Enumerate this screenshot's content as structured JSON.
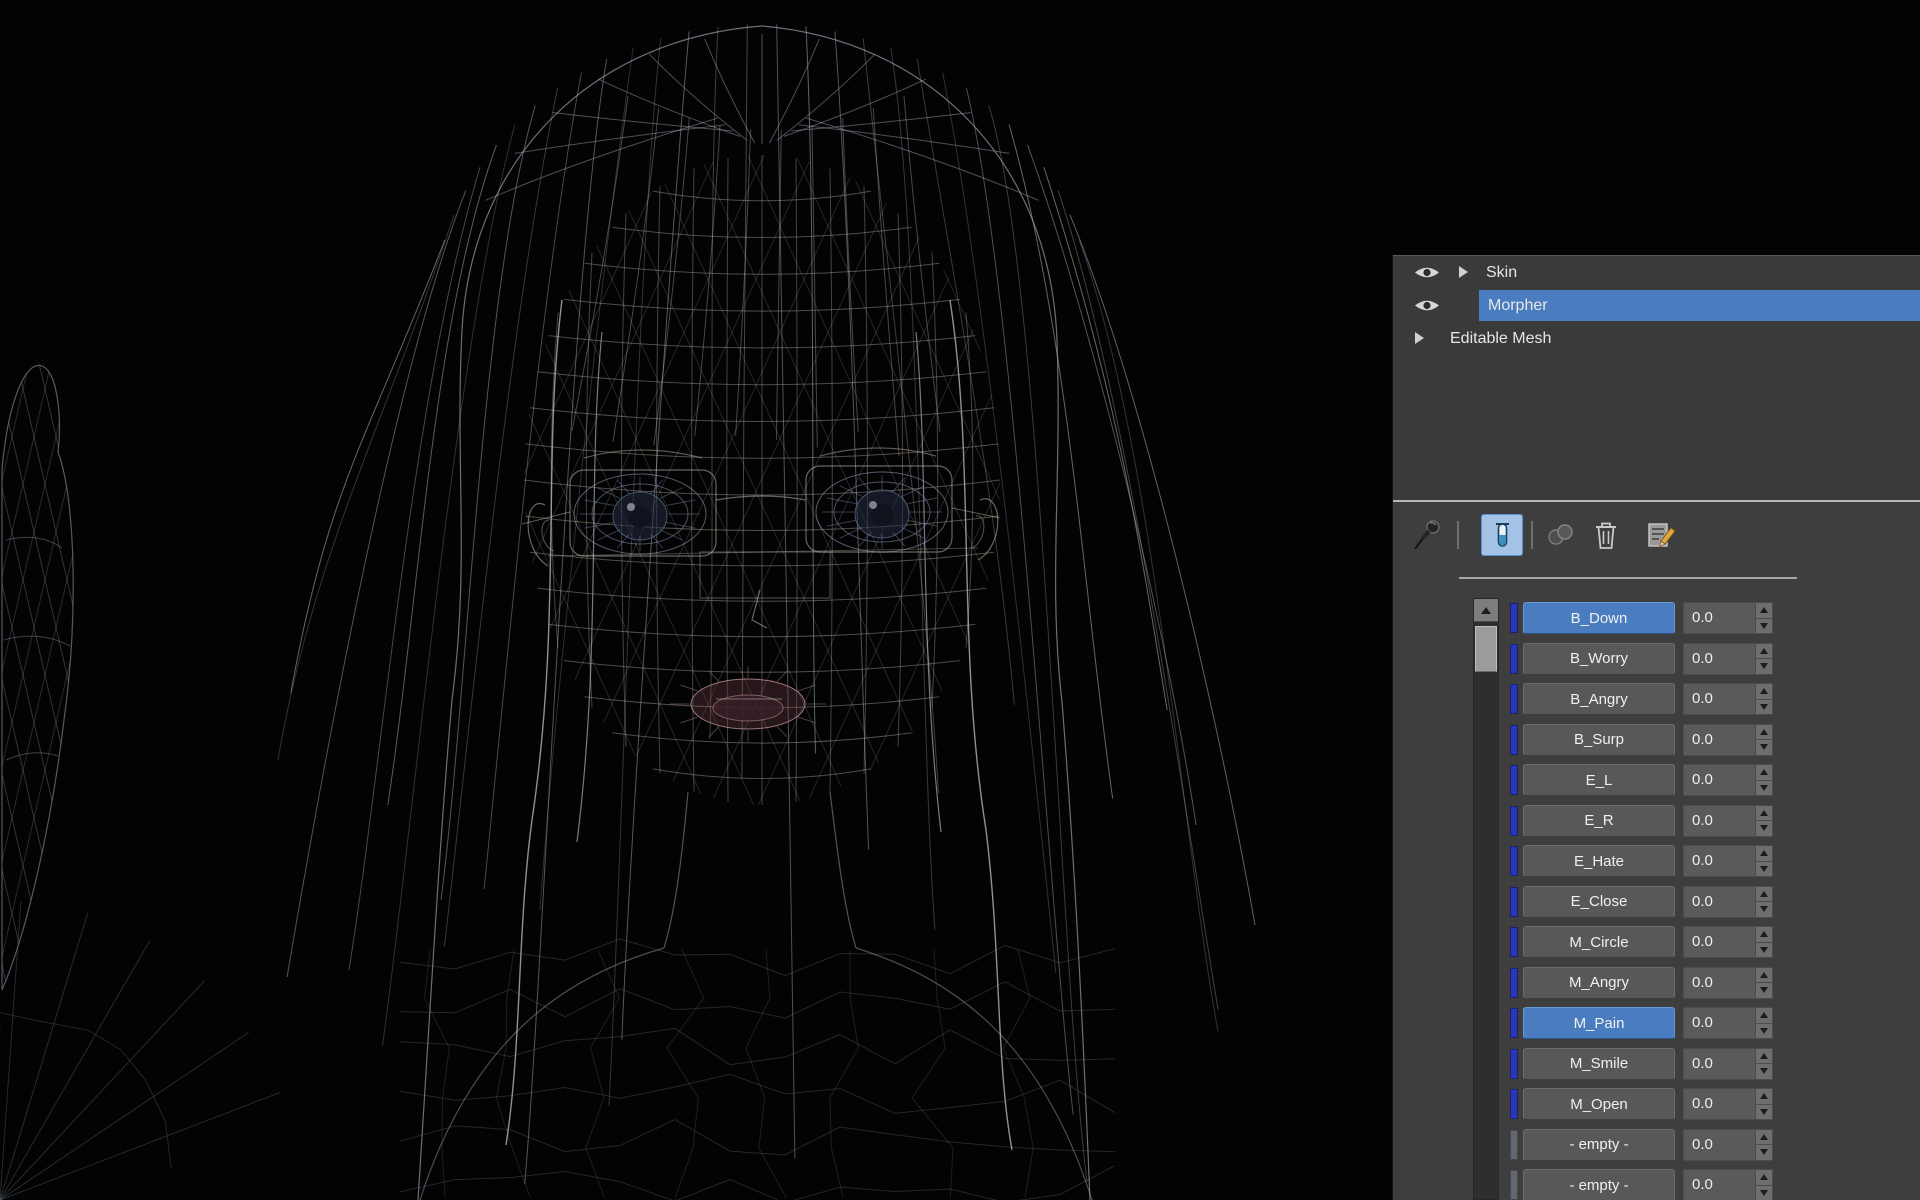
{
  "colors": {
    "selection_blue": "#4a7dbf",
    "panel_bg": "#3e3e3e",
    "channel_marker_blue": "#2936b8",
    "viewport_bg": "#030303"
  },
  "modifier_stack": {
    "items": [
      {
        "label": "Skin",
        "eye_visible": true,
        "expand_arrow": true,
        "selected": false
      },
      {
        "label": "Morpher",
        "eye_visible": true,
        "expand_arrow": false,
        "selected": true
      },
      {
        "label": "Editable Mesh",
        "eye_visible": false,
        "expand_arrow": true,
        "selected": false
      }
    ]
  },
  "stack_toolbar": {
    "buttons": [
      {
        "name": "pin-stack",
        "icon": "pushpin-icon",
        "active": false,
        "disabled": false
      },
      {
        "name": "show-end-result",
        "icon": "test-tube-icon",
        "active": true,
        "disabled": false
      },
      {
        "name": "make-unique",
        "icon": "two-spheres-icon",
        "active": false,
        "disabled": true
      },
      {
        "name": "remove-modifier",
        "icon": "trash-icon",
        "active": false,
        "disabled": false
      },
      {
        "name": "configure-modifier-sets",
        "icon": "list-pencil-icon",
        "active": false,
        "disabled": false
      }
    ]
  },
  "morph_channels": {
    "rows": [
      {
        "name": "B_Down",
        "value": "0.0",
        "selected": true,
        "empty": false
      },
      {
        "name": "B_Worry",
        "value": "0.0",
        "selected": false,
        "empty": false
      },
      {
        "name": "B_Angry",
        "value": "0.0",
        "selected": false,
        "empty": false
      },
      {
        "name": "B_Surp",
        "value": "0.0",
        "selected": false,
        "empty": false
      },
      {
        "name": "E_L",
        "value": "0.0",
        "selected": false,
        "empty": false
      },
      {
        "name": "E_R",
        "value": "0.0",
        "selected": false,
        "empty": false
      },
      {
        "name": "E_Hate",
        "value": "0.0",
        "selected": false,
        "empty": false
      },
      {
        "name": "E_Close",
        "value": "0.0",
        "selected": false,
        "empty": false
      },
      {
        "name": "M_Circle",
        "value": "0.0",
        "selected": false,
        "empty": false
      },
      {
        "name": "M_Angry",
        "value": "0.0",
        "selected": false,
        "empty": false
      },
      {
        "name": "M_Pain",
        "value": "0.0",
        "selected": true,
        "empty": false
      },
      {
        "name": "M_Smile",
        "value": "0.0",
        "selected": false,
        "empty": false
      },
      {
        "name": "M_Open",
        "value": "0.0",
        "selected": false,
        "empty": false
      },
      {
        "name": "- empty -",
        "value": "0.0",
        "selected": false,
        "empty": true
      },
      {
        "name": "- empty -",
        "value": "0.0",
        "selected": false,
        "empty": true
      }
    ]
  }
}
